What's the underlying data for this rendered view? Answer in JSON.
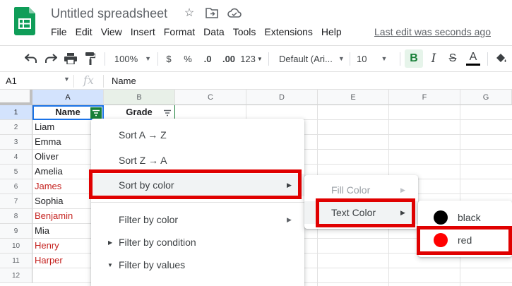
{
  "title": "Untitled spreadsheet",
  "menubar": [
    "File",
    "Edit",
    "View",
    "Insert",
    "Format",
    "Data",
    "Tools",
    "Extensions",
    "Help"
  ],
  "last_edit": "Last edit was seconds ago",
  "toolbar": {
    "zoom": "100%",
    "currency": "$",
    "percent": "%",
    "decrease_decimal": ".0",
    "increase_decimal": ".00",
    "more_formats": "123",
    "font": "Default (Ari...",
    "font_size": "10",
    "bold": "B",
    "italic": "I",
    "strike": "S",
    "text_color": "A"
  },
  "formula_bar": {
    "name_box": "A1",
    "fx": "fx",
    "value": "Name"
  },
  "columns": [
    "A",
    "B",
    "C",
    "D",
    "E",
    "F",
    "G"
  ],
  "rows": [
    "1",
    "2",
    "3",
    "4",
    "5",
    "6",
    "7",
    "8",
    "9",
    "10",
    "11",
    "12"
  ],
  "header_row": {
    "a": "Name",
    "b": "Grade"
  },
  "names": [
    {
      "text": "Liam",
      "color": "black"
    },
    {
      "text": "Emma",
      "color": "black"
    },
    {
      "text": "Oliver",
      "color": "black"
    },
    {
      "text": "Amelia",
      "color": "black"
    },
    {
      "text": "James",
      "color": "red"
    },
    {
      "text": "Sophia",
      "color": "black"
    },
    {
      "text": "Benjamin",
      "color": "red"
    },
    {
      "text": "Mia",
      "color": "black"
    },
    {
      "text": "Henry",
      "color": "red"
    },
    {
      "text": "Harper",
      "color": "red"
    }
  ],
  "filter_menu": {
    "sort_az": "Sort A → Z",
    "sort_za": "Sort Z → A",
    "sort_by_color": "Sort by color",
    "filter_by_color": "Filter by color",
    "filter_by_condition": "Filter by condition",
    "filter_by_values": "Filter by values"
  },
  "color_submenu": {
    "fill_color": "Fill Color",
    "text_color": "Text Color"
  },
  "text_color_submenu": [
    {
      "label": "black",
      "color": "#000000"
    },
    {
      "label": "red",
      "color": "#ff0000"
    }
  ],
  "colors": {
    "highlight": "#e00000",
    "red_text": "#c5221f",
    "selection": "#d3e3fd",
    "filter_active": "#188038",
    "sheets_green": "#0f9d58"
  }
}
